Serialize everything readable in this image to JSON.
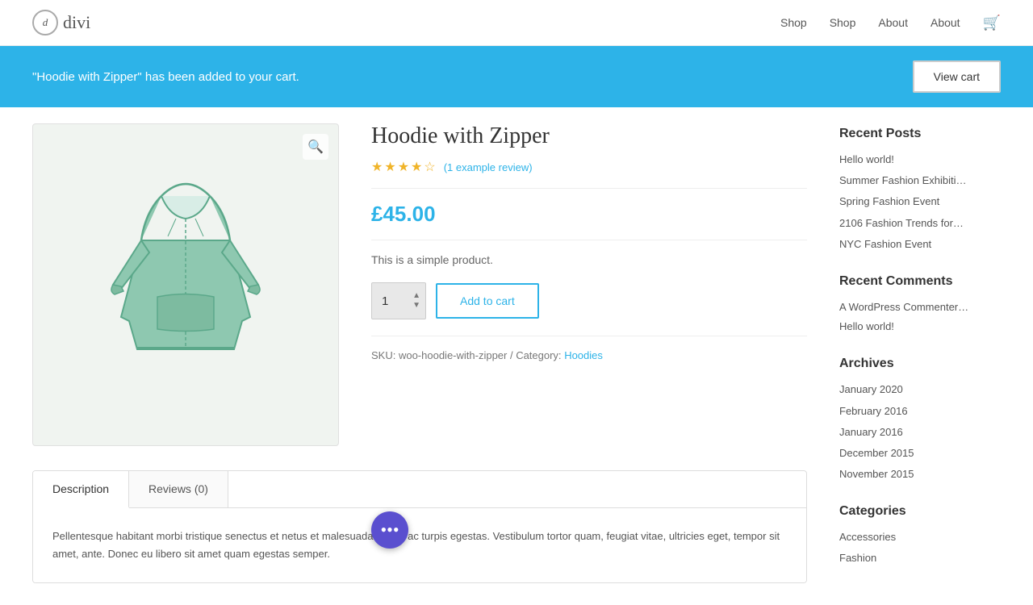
{
  "header": {
    "logo_letter": "d",
    "logo_text": "divi",
    "nav": [
      {
        "label": "Shop",
        "href": "#"
      },
      {
        "label": "Shop",
        "href": "#"
      },
      {
        "label": "About",
        "href": "#"
      },
      {
        "label": "About",
        "href": "#"
      }
    ],
    "cart_icon": "🛒"
  },
  "notification": {
    "message": "\"Hoodie with Zipper\" has been added to your cart.",
    "button_label": "View cart"
  },
  "product": {
    "title": "Hoodie with Zipper",
    "rating_value": "4",
    "review_text": "(1 example review)",
    "price": "£45.00",
    "description": "This is a simple product.",
    "quantity": "1",
    "add_to_cart_label": "Add to cart",
    "sku": "SKU: woo-hoodie-with-zipper / Category:",
    "category_link": "Hoodies"
  },
  "tabs": [
    {
      "label": "Description",
      "active": true
    },
    {
      "label": "Reviews (0)",
      "active": false
    }
  ],
  "tabs_content": {
    "description": "Pellentesque habitant morbi tristique senectus et netus et malesuada fames ac turpis egestas. Vestibulum tortor quam, feugiat vitae, ultricies eget, tempor sit amet, ante. Donec eu libero sit amet quam egestas semper."
  },
  "sidebar": {
    "recent_posts_heading": "Recent Posts",
    "recent_posts": [
      {
        "label": "Hello world!"
      },
      {
        "label": "Summer Fashion Exhibiti…"
      },
      {
        "label": "Spring Fashion Event"
      },
      {
        "label": "2106 Fashion Trends for…"
      },
      {
        "label": "NYC Fashion Event"
      }
    ],
    "recent_comments_heading": "Recent Comments",
    "recent_comments": [
      {
        "label": "A WordPress Commenter…"
      },
      {
        "label": "Hello world!"
      }
    ],
    "archives_heading": "Archives",
    "archives": [
      {
        "label": "January 2020"
      },
      {
        "label": "February 2016"
      },
      {
        "label": "January 2016"
      },
      {
        "label": "December 2015"
      },
      {
        "label": "November 2015"
      }
    ],
    "categories_heading": "Categories",
    "categories": [
      {
        "label": "Accessories"
      },
      {
        "label": "Fashion"
      }
    ]
  },
  "floating_btn": {
    "icon": "···"
  }
}
